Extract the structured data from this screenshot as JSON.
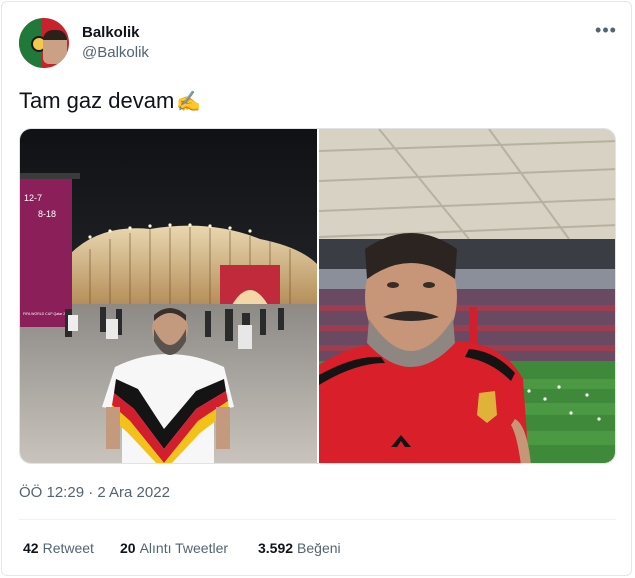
{
  "author": {
    "name": "Balkolik",
    "handle": "@Balkolik",
    "avatar_icon": "portugal-flag-avatar"
  },
  "more_icon": "more-options-icon",
  "tweet": {
    "text": "Tam gaz devam",
    "emoji": "✍️"
  },
  "media": {
    "left_photo": {
      "stadium_sign_1": "12-7",
      "stadium_sign_2": "8-18",
      "sign_caption": "FIFA WORLD CUP Qatar 2022"
    },
    "right_photo": {}
  },
  "timestamp": "ÖÖ 12:29 · 2 Ara 2022",
  "stats": {
    "retweets": {
      "count": "42",
      "label": "Retweet"
    },
    "quotes": {
      "count": "20",
      "label": "Alıntı Tweetler"
    },
    "likes": {
      "count": "3.592",
      "label": "Beğeni"
    }
  },
  "colors": {
    "text": "#0f1419",
    "muted": "#536471",
    "belgium_red": "#d81f2a",
    "pitch_green": "#3f8a3a"
  }
}
